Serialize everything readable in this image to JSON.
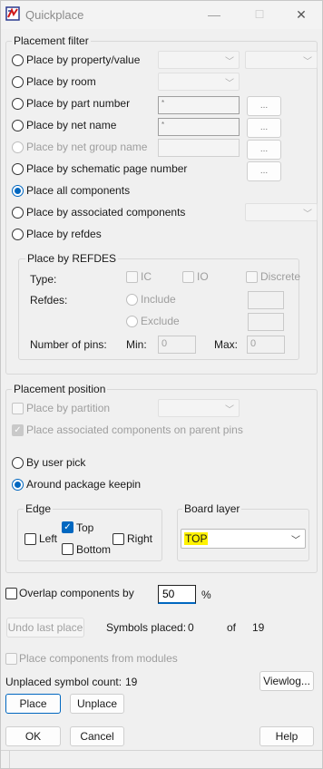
{
  "window": {
    "title": "Quickplace",
    "minimize_glyph": "—",
    "maximize_glyph": "☐",
    "close_glyph": "✕"
  },
  "placement_filter": {
    "label": "Placement filter",
    "options": {
      "property_value": "Place by property/value",
      "room": "Place by room",
      "part_number": "Place by part number",
      "net_name": "Place by net name",
      "net_group_name": "Place by net group name",
      "schematic_page": "Place by schematic page number",
      "all_components": "Place all components",
      "associated": "Place by associated components",
      "refdes": "Place by refdes"
    },
    "part_number_value": "*",
    "net_name_value": "*",
    "browse_label": "...",
    "refdes_group": {
      "label": "Place by REFDES",
      "type_label": "Type:",
      "ic_label": "IC",
      "io_label": "IO",
      "discrete_label": "Discrete",
      "refdes_label": "Refdes:",
      "include_label": "Include",
      "exclude_label": "Exclude",
      "pins_label": "Number of pins:",
      "min_label": "Min:",
      "min_value": "0",
      "max_label": "Max:",
      "max_value": "0"
    }
  },
  "placement_position": {
    "label": "Placement position",
    "by_partition": "Place by partition",
    "associated_parent_pins": "Place associated components on parent pins",
    "by_user_pick": "By user pick",
    "around_keepin": "Around package keepin",
    "edge": {
      "label": "Edge",
      "left": "Left",
      "top": "Top",
      "right": "Right",
      "bottom": "Bottom"
    },
    "board_layer": {
      "label": "Board layer",
      "value": "TOP"
    }
  },
  "overlap": {
    "label": "Overlap components by",
    "value": "50",
    "unit": "%"
  },
  "undo_label": "Undo last place",
  "symbols_placed": {
    "label": "Symbols placed:",
    "placed": "0",
    "of": "of",
    "total": "19"
  },
  "modules_label": "Place components from modules",
  "unplaced": {
    "label": "Unplaced symbol count:",
    "value": "19"
  },
  "buttons": {
    "viewlog": "Viewlog...",
    "place": "Place",
    "unplace": "Unplace",
    "ok": "OK",
    "cancel": "Cancel",
    "help": "Help"
  },
  "colors": {
    "accent": "#0067c0",
    "highlight": "#fff200"
  },
  "icons": {
    "app": "app-icon",
    "dropdown": "chevron-down-icon"
  }
}
